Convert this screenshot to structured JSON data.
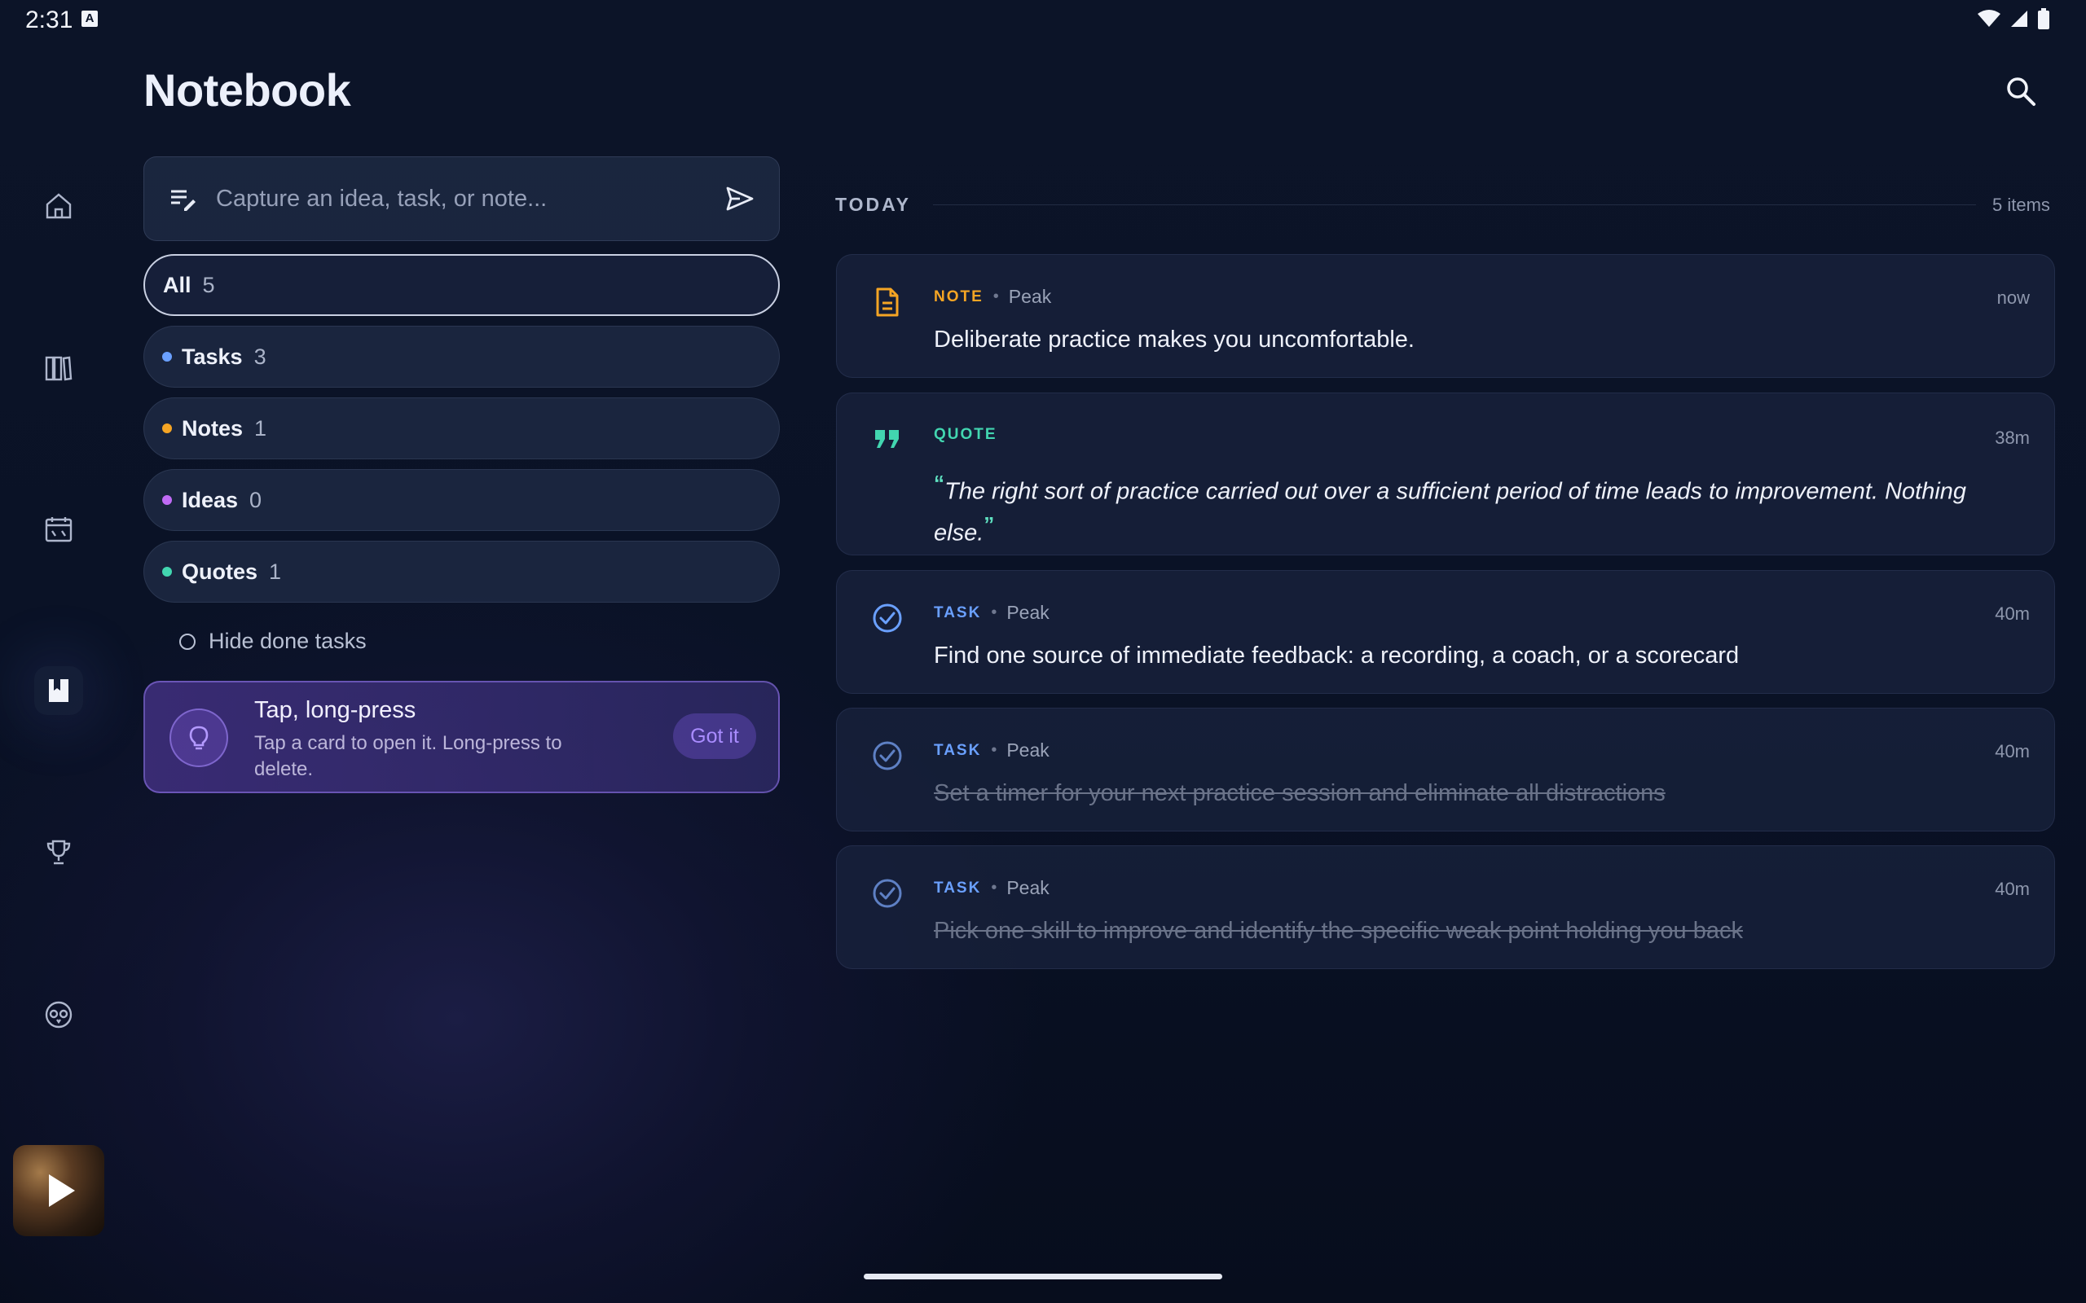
{
  "status": {
    "time": "2:31",
    "badge": "A"
  },
  "header": {
    "title": "Notebook"
  },
  "capture": {
    "placeholder": "Capture an idea, task, or note..."
  },
  "filters": [
    {
      "label": "All",
      "count": "5",
      "dot": ""
    },
    {
      "label": "Tasks",
      "count": "3",
      "dot": "#6aa0ff"
    },
    {
      "label": "Notes",
      "count": "1",
      "dot": "#f5a524"
    },
    {
      "label": "Ideas",
      "count": "0",
      "dot": "#c06bf5"
    },
    {
      "label": "Quotes",
      "count": "1",
      "dot": "#42d6b0"
    }
  ],
  "hide_done": {
    "label": "Hide done tasks"
  },
  "tip": {
    "title": "Tap, long-press",
    "body": "Tap a card to open it. Long-press to delete.",
    "button": "Got it"
  },
  "section": {
    "label": "TODAY",
    "count": "5 items"
  },
  "cards": [
    {
      "type": "NOTE",
      "type_color": "#f5a524",
      "source": "Peak",
      "time": "now",
      "text": "Deliberate practice makes you uncomfortable.",
      "icon": "note-icon"
    },
    {
      "type": "QUOTE",
      "type_color": "#42d6b0",
      "source": "",
      "time": "38m",
      "text": "The right sort of practice  carried out over a sufficient period of time leads to improvement. Nothing else.",
      "icon": "quote-icon"
    },
    {
      "type": "TASK",
      "type_color": "#6aa0ff",
      "source": "Peak",
      "time": "40m",
      "text": "Find one source of immediate feedback: a recording, a coach, or a scorecard",
      "icon": "check-circle-icon",
      "done": false
    },
    {
      "type": "TASK",
      "type_color": "#6aa0ff",
      "source": "Peak",
      "time": "40m",
      "text": "Set a timer for your next practice session and eliminate all distractions",
      "icon": "check-circle-icon",
      "done": true
    },
    {
      "type": "TASK",
      "type_color": "#6aa0ff",
      "source": "Peak",
      "time": "40m",
      "text": "Pick one skill to improve and identify the specific weak point holding you back",
      "icon": "check-circle-icon",
      "done": true
    }
  ],
  "nav": [
    "home-icon",
    "library-icon",
    "calendar-icon",
    "notebook-icon",
    "trophy-icon",
    "owl-icon"
  ]
}
